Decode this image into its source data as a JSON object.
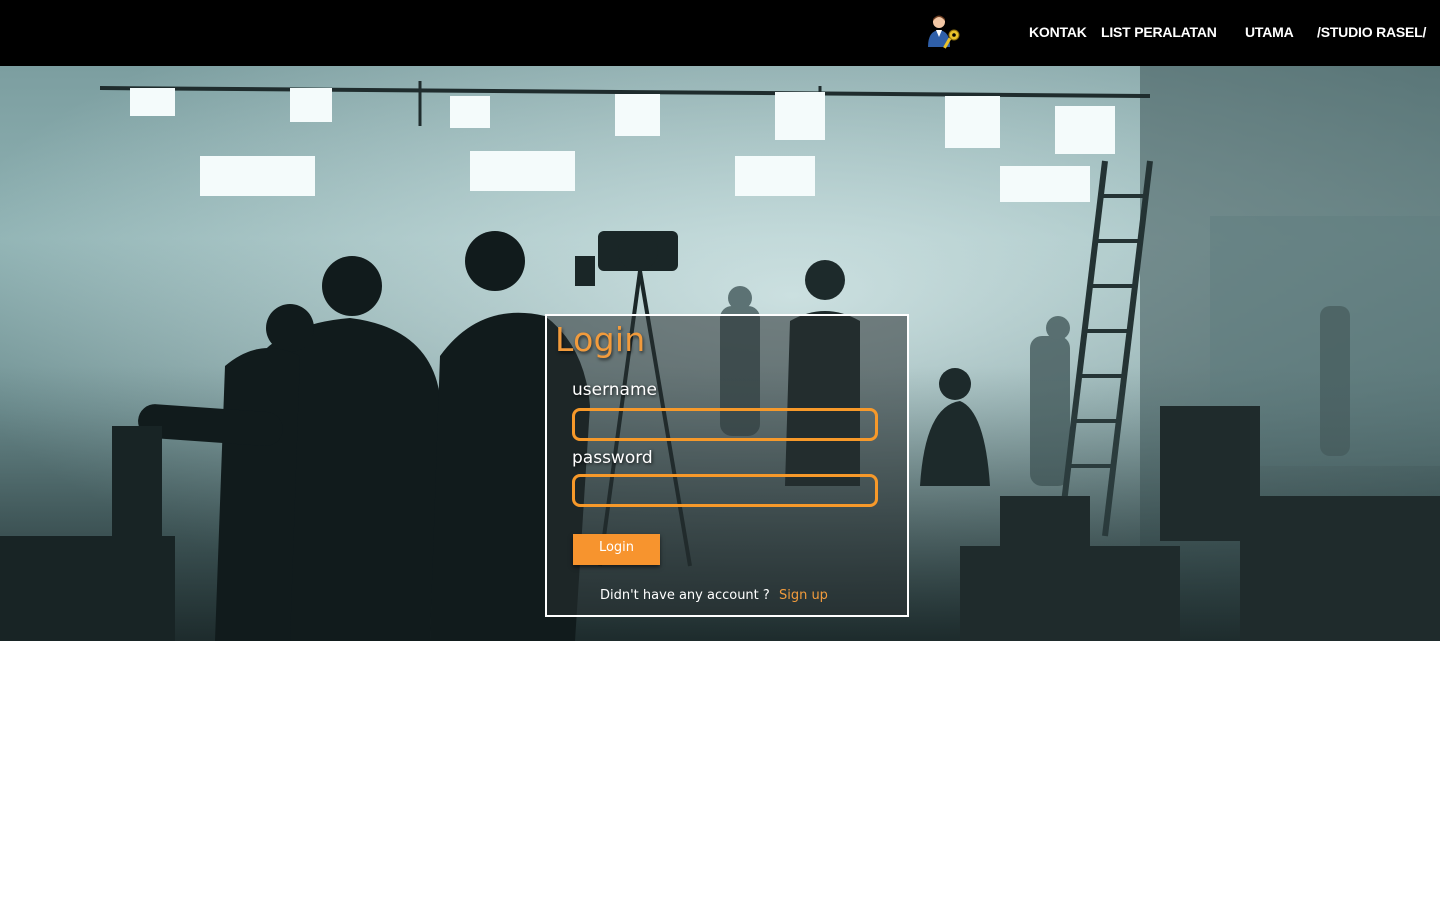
{
  "nav": {
    "links": [
      {
        "label": "KONTAK"
      },
      {
        "label": "LIST PERALATAN"
      },
      {
        "label": "UTAMA"
      },
      {
        "label": "/STUDIO RASEL/"
      }
    ],
    "avatar_icon": "user-key-icon"
  },
  "login": {
    "title": "Login",
    "username_label": "username",
    "username_value": "",
    "password_label": "password",
    "password_value": "",
    "submit_label": "Login",
    "signup_prompt": "Didn't have any account ?",
    "signup_link": "Sign up"
  },
  "colors": {
    "accent": "#f7942e",
    "navbar": "#000000",
    "page_background": "#ffffff"
  }
}
